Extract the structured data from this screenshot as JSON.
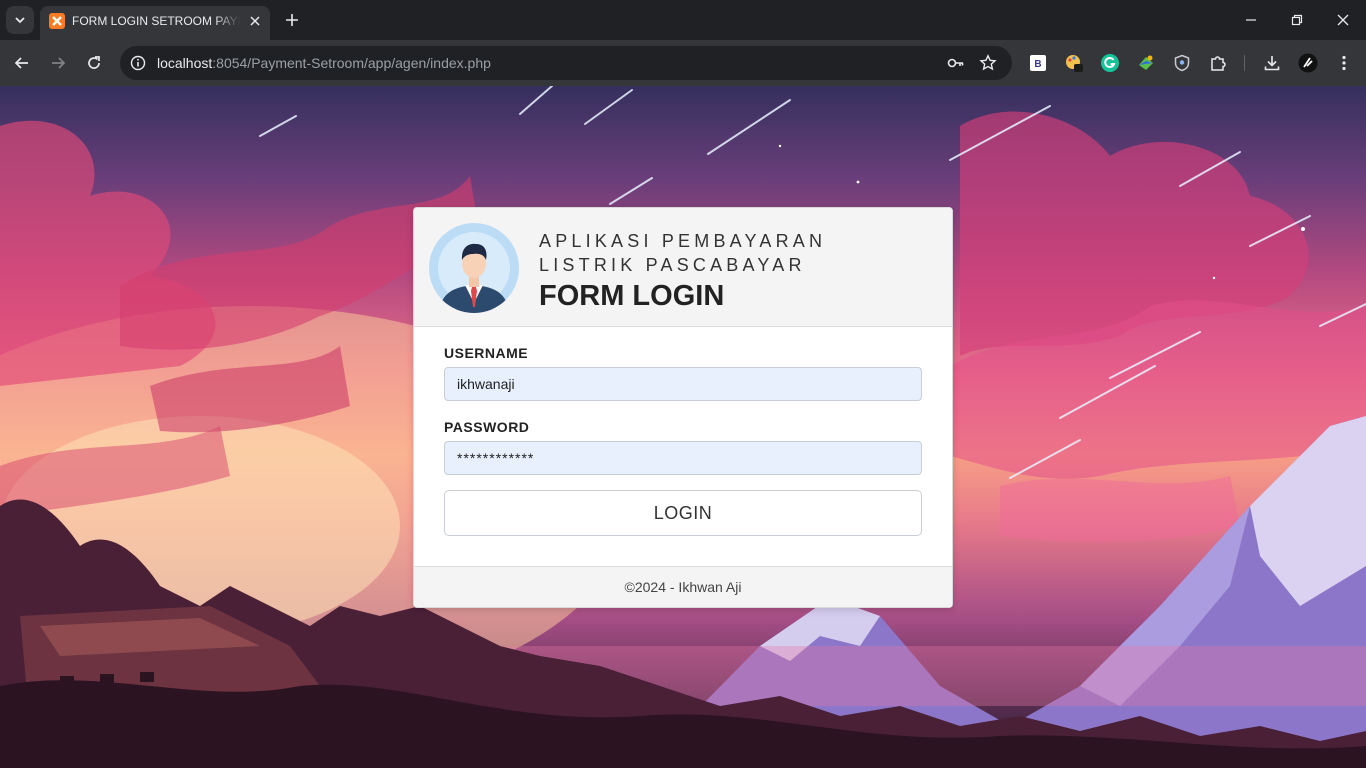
{
  "browser": {
    "tab": {
      "title": "FORM LOGIN SETROOM PAYMENT"
    },
    "address_bar": {
      "host": "localhost",
      "path": ":8054/Payment-Setroom/app/agen/index.php"
    },
    "extensions": [
      "b-extension-icon",
      "paint-extension-icon",
      "grammarly-icon",
      "globe-extension-icon",
      "shield-extension-icon",
      "puzzle-icon"
    ],
    "colors": {
      "tab_bar": "#202124",
      "toolbar": "#35363a",
      "omnibox": "#202124"
    }
  },
  "login": {
    "app_title_line1": "APLIKASI PEMBAYARAN",
    "app_title_line2": "LISTRIK PASCABAYAR",
    "form_title": "FORM LOGIN",
    "username_label": "USERNAME",
    "username_value": "ikhwanaji",
    "password_label": "PASSWORD",
    "password_value": "************",
    "login_button": "LOGIN",
    "footer": "©2024 - Ikhwan Aji",
    "colors": {
      "input_bg": "#e8f0fe",
      "header_bg": "#f4f4f4",
      "avatar_bg": "#bcdcf5",
      "suit": "#2c4a6e",
      "tie": "#e2474b"
    }
  }
}
